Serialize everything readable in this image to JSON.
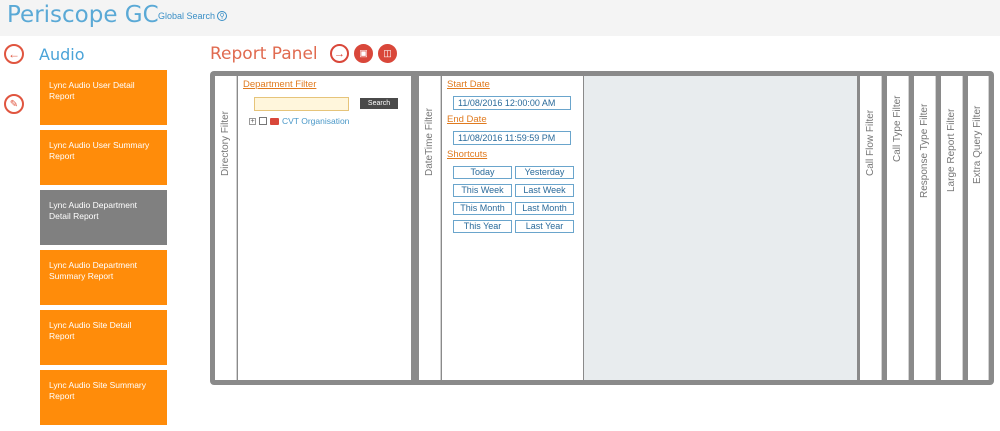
{
  "app": {
    "title": "Periscope GC",
    "global_search": "Global Search"
  },
  "sidebar": {
    "title": "Audio",
    "items": [
      {
        "label": "Lync Audio User Detail Report"
      },
      {
        "label": "Lync Audio User Summary Report"
      },
      {
        "label": "Lync Audio Department Detail Report",
        "active": true
      },
      {
        "label": "Lync Audio Department Summary Report"
      },
      {
        "label": "Lync Audio Site Detail Report"
      },
      {
        "label": "Lync Audio Site Summary Report"
      }
    ]
  },
  "panel": {
    "title": "Report Panel",
    "directory_filter_label": "Directory Filter",
    "department_filter": "Department Filter",
    "search_button": "Search",
    "tree_root": "CVT Organisation",
    "datetime_filter_label": "DateTime Filter",
    "start_date_label": "Start Date",
    "start_date_value": "11/08/2016 12:00:00 AM",
    "end_date_label": "End Date",
    "end_date_value": "11/08/2016 11:59:59 PM",
    "shortcuts_label": "Shortcuts",
    "shortcuts": [
      "Today",
      "Yesterday",
      "This Week",
      "Last Week",
      "This Month",
      "Last Month",
      "This Year",
      "Last Year"
    ],
    "right_tabs": [
      "Call Flow Filter",
      "Call Type Filter",
      "Response Type Filter",
      "Large Report Filter",
      "Extra Query Filter"
    ]
  },
  "colors": {
    "accent_orange": "#ff8c0a",
    "active_gray": "#808080",
    "title_blue": "#5aa9d6",
    "tool_red": "#d9473a"
  },
  "icons": {
    "back": "arrow-left-icon",
    "edit": "pencil-icon",
    "run": "arrow-right-icon",
    "save": "save-icon",
    "export": "export-icon",
    "search": "search-icon"
  }
}
